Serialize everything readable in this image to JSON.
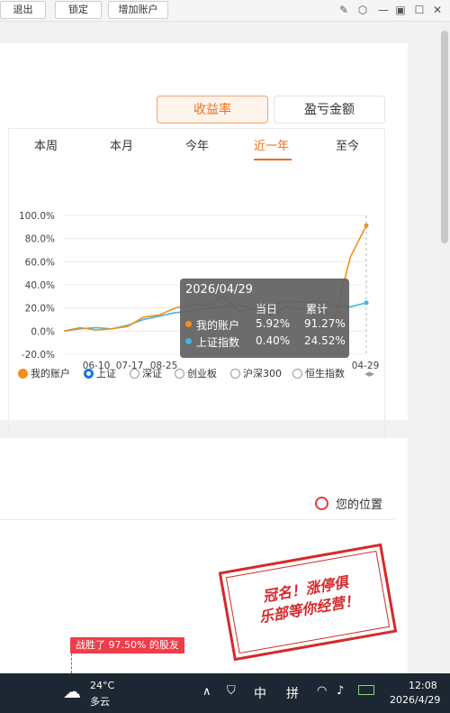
{
  "toolbar": {
    "buttons": [
      "退出",
      "锁定",
      "增加账户"
    ]
  },
  "toggles": {
    "active": "收益率",
    "inactive": "盈亏金额"
  },
  "tabs": [
    "本周",
    "本月",
    "今年",
    "近一年",
    "至今"
  ],
  "active_tab": "近一年",
  "tooltip": {
    "date": "2026/04/29",
    "col1": "当日",
    "col2": "累计",
    "rows": [
      {
        "name": "我的账户",
        "day": "5.92%",
        "total": "91.27%",
        "color": "#f39019"
      },
      {
        "name": "上证指数",
        "day": "0.40%",
        "total": "24.52%",
        "color": "#3db7e4"
      }
    ]
  },
  "chart_data": {
    "type": "line",
    "x": [
      "2025-04-29",
      "2025-05-14",
      "2025-05-29",
      "2025-06-10",
      "2025-06-25",
      "2025-07-17",
      "2025-08-05",
      "2025-08-25",
      "2025-09-15",
      "2025-10-10",
      "2025-11-05",
      "2025-11-25",
      "2025-12-15",
      "2026-01-10",
      "2026-02-05",
      "2026-03-01",
      "2026-03-20",
      "2026-04-08",
      "2026-04-18",
      "2026-04-29"
    ],
    "series": [
      {
        "name": "我的账户",
        "color": "#f39019",
        "values": [
          0,
          3,
          1,
          2,
          4,
          12,
          14,
          20,
          23,
          22,
          30,
          17,
          20,
          14,
          21,
          19,
          23,
          10,
          64,
          91.27
        ]
      },
      {
        "name": "上证指数",
        "color": "#3db7e4",
        "values": [
          0,
          2,
          3,
          2,
          5,
          10,
          13,
          16,
          17,
          20,
          21,
          22,
          19,
          23,
          26,
          25,
          26,
          22,
          21,
          24.52
        ]
      }
    ],
    "ylim": [
      -20,
      100
    ],
    "yticks": [
      "100.0%",
      "80.0%",
      "60.0%",
      "40.0%",
      "20.0%",
      "0.0%",
      "-20.0%"
    ],
    "xticks": [
      "06-10",
      "07-17",
      "08-25",
      "04-29"
    ]
  },
  "legend": [
    "我的账户",
    "上证",
    "深证",
    "创业板",
    "沪深300",
    "恒生指数"
  ],
  "position_label": "您的位置",
  "beat_text": "战胜了 97.50% 的股友",
  "stamp_lines": [
    "冠名！涨停俱",
    "乐部等你经营！"
  ],
  "taskbar": {
    "temp": "24°C",
    "weather": "多云",
    "ime1": "中",
    "ime2": "拼",
    "time": "12:08",
    "date": "2026/4/29"
  }
}
